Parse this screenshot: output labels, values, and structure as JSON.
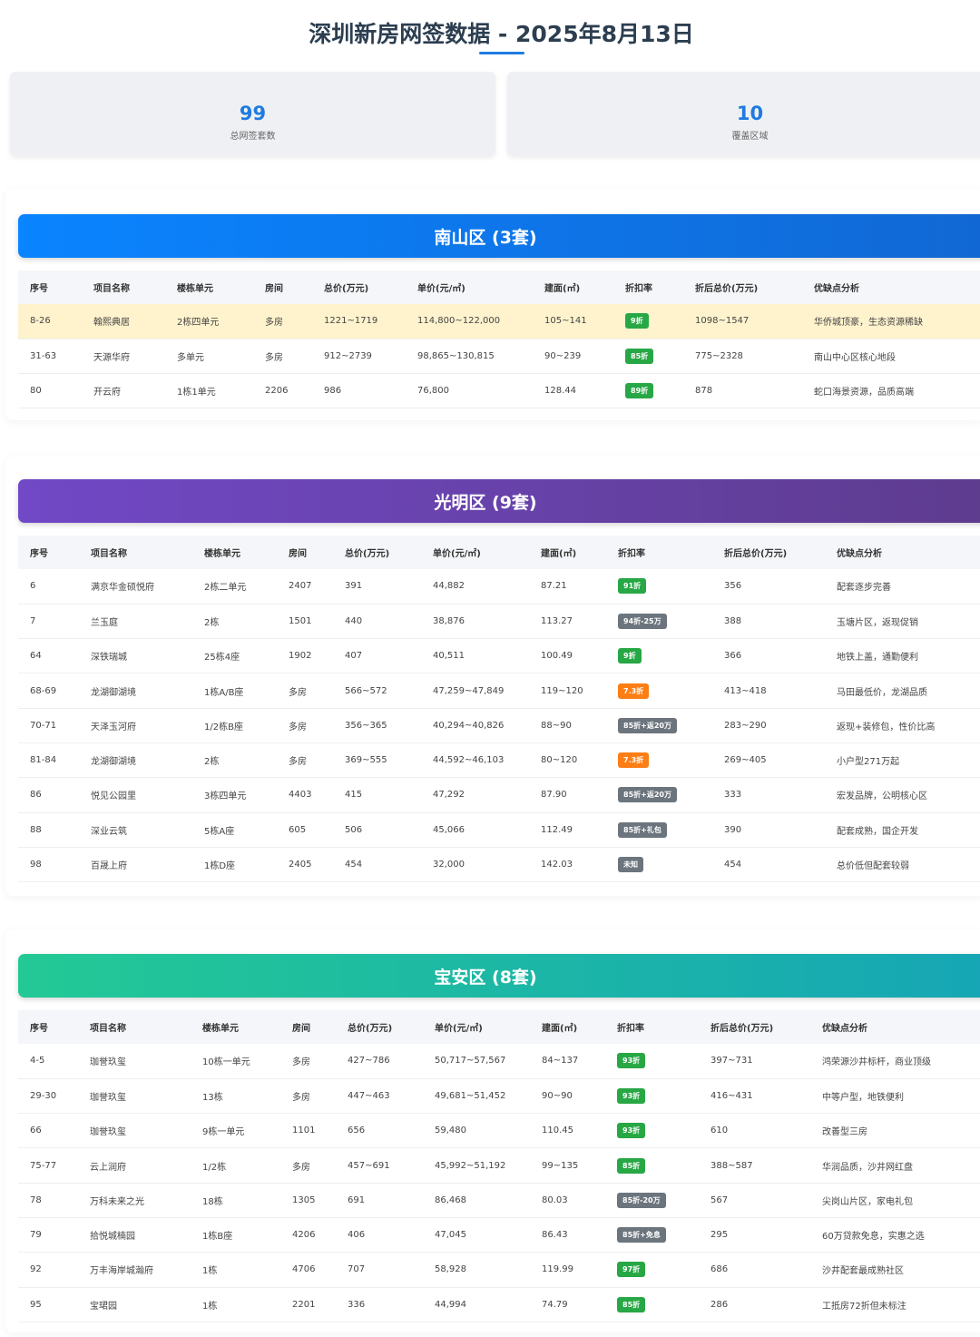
{
  "title": "深圳新房网签数据 - 2025年8月13日",
  "stats": [
    {
      "value": "99",
      "label": "总网签套数"
    },
    {
      "value": "10",
      "label": "覆盖区域"
    }
  ],
  "colors": {
    "accent": "#1e7be0",
    "green": "#28a745",
    "orange": "#fd7e14",
    "gray": "#6c757d",
    "highlight": "#fff3cd"
  },
  "districts": [
    {
      "title": "南山区 (3套)",
      "theme": "blue",
      "headers": [
        "序号",
        "项目名称",
        "楼栋单元",
        "房间",
        "总价(万元)",
        "单价(元/㎡)",
        "建面(㎡)",
        "折扣率",
        "折后总价(万元)",
        "优缺点分析"
      ],
      "rows": [
        {
          "no": "8-26",
          "project": "翰熙典居",
          "unit": "2栋四单元",
          "room": "多房",
          "total": "1221~1719",
          "unit_price": "114,800~122,000",
          "area": "105~141",
          "discount": "9折",
          "badge": "green",
          "after": "1098~1547",
          "note": "华侨城顶豪，生态资源稀缺",
          "highlight": true
        },
        {
          "no": "31-63",
          "project": "天源华府",
          "unit": "多单元",
          "room": "多房",
          "total": "912~2739",
          "unit_price": "98,865~130,815",
          "area": "90~239",
          "discount": "85折",
          "badge": "green",
          "after": "775~2328",
          "note": "南山中心区核心地段"
        },
        {
          "no": "80",
          "project": "开云府",
          "unit": "1栋1单元",
          "room": "2206",
          "total": "986",
          "unit_price": "76,800",
          "area": "128.44",
          "discount": "89折",
          "badge": "green",
          "after": "878",
          "note": "蛇口海景资源，品质高端"
        }
      ]
    },
    {
      "title": "光明区 (9套)",
      "theme": "purple",
      "headers": [
        "序号",
        "项目名称",
        "楼栋单元",
        "房间",
        "总价(万元)",
        "单价(元/㎡)",
        "建面(㎡)",
        "折扣率",
        "折后总价(万元)",
        "优缺点分析"
      ],
      "rows": [
        {
          "no": "6",
          "project": "满京华金硕悦府",
          "unit": "2栋二单元",
          "room": "2407",
          "total": "391",
          "unit_price": "44,882",
          "area": "87.21",
          "discount": "91折",
          "badge": "green",
          "after": "356",
          "note": "配套逐步完善"
        },
        {
          "no": "7",
          "project": "兰玉庭",
          "unit": "2栋",
          "room": "1501",
          "total": "440",
          "unit_price": "38,876",
          "area": "113.27",
          "discount": "94折-25万",
          "badge": "gray",
          "after": "388",
          "note": "玉塘片区，返现促销"
        },
        {
          "no": "64",
          "project": "深铁瑞城",
          "unit": "25栋4座",
          "room": "1902",
          "total": "407",
          "unit_price": "40,511",
          "area": "100.49",
          "discount": "9折",
          "badge": "green",
          "after": "366",
          "note": "地铁上盖，通勤便利"
        },
        {
          "no": "68-69",
          "project": "龙湖御湖境",
          "unit": "1栋A/B座",
          "room": "多房",
          "total": "566~572",
          "unit_price": "47,259~47,849",
          "area": "119~120",
          "discount": "7.3折",
          "badge": "orange",
          "after": "413~418",
          "note": "马田最低价，龙湖品质"
        },
        {
          "no": "70-71",
          "project": "天泽玉河府",
          "unit": "1/2栋B座",
          "room": "多房",
          "total": "356~365",
          "unit_price": "40,294~40,826",
          "area": "88~90",
          "discount": "85折+返20万",
          "badge": "gray",
          "after": "283~290",
          "note": "返现+装修包，性价比高"
        },
        {
          "no": "81-84",
          "project": "龙湖御湖境",
          "unit": "2栋",
          "room": "多房",
          "total": "369~555",
          "unit_price": "44,592~46,103",
          "area": "80~120",
          "discount": "7.3折",
          "badge": "orange",
          "after": "269~405",
          "note": "小户型271万起"
        },
        {
          "no": "86",
          "project": "悦见公园里",
          "unit": "3栋四单元",
          "room": "4403",
          "total": "415",
          "unit_price": "47,292",
          "area": "87.90",
          "discount": "85折+返20万",
          "badge": "gray",
          "after": "333",
          "note": "宏发品牌，公明核心区"
        },
        {
          "no": "88",
          "project": "深业云筑",
          "unit": "5栋A座",
          "room": "605",
          "total": "506",
          "unit_price": "45,066",
          "area": "112.49",
          "discount": "85折+礼包",
          "badge": "gray",
          "after": "390",
          "note": "配套成熟，国企开发"
        },
        {
          "no": "98",
          "project": "百晟上府",
          "unit": "1栋D座",
          "room": "2405",
          "total": "454",
          "unit_price": "32,000",
          "area": "142.03",
          "discount": "未知",
          "badge": "gray",
          "after": "454",
          "note": "总价低但配套较弱"
        }
      ]
    },
    {
      "title": "宝安区 (8套)",
      "theme": "teal",
      "headers": [
        "序号",
        "项目名称",
        "楼栋单元",
        "房间",
        "总价(万元)",
        "单价(元/㎡)",
        "建面(㎡)",
        "折扣率",
        "折后总价(万元)",
        "优缺点分析"
      ],
      "rows": [
        {
          "no": "4-5",
          "project": "珈誉玖玺",
          "unit": "10栋一单元",
          "room": "多房",
          "total": "427~786",
          "unit_price": "50,717~57,567",
          "area": "84~137",
          "discount": "93折",
          "badge": "green",
          "after": "397~731",
          "note": "鸿荣源沙井标杆，商业顶级"
        },
        {
          "no": "29-30",
          "project": "珈誉玖玺",
          "unit": "13栋",
          "room": "多房",
          "total": "447~463",
          "unit_price": "49,681~51,452",
          "area": "90~90",
          "discount": "93折",
          "badge": "green",
          "after": "416~431",
          "note": "中等户型，地铁便利"
        },
        {
          "no": "66",
          "project": "珈誉玖玺",
          "unit": "9栋一单元",
          "room": "1101",
          "total": "656",
          "unit_price": "59,480",
          "area": "110.45",
          "discount": "93折",
          "badge": "green",
          "after": "610",
          "note": "改善型三房"
        },
        {
          "no": "75-77",
          "project": "云上润府",
          "unit": "1/2栋",
          "room": "多房",
          "total": "457~691",
          "unit_price": "45,992~51,192",
          "area": "99~135",
          "discount": "85折",
          "badge": "green",
          "after": "388~587",
          "note": "华润品质，沙井网红盘"
        },
        {
          "no": "78",
          "project": "万科未来之光",
          "unit": "18栋",
          "room": "1305",
          "total": "691",
          "unit_price": "86,468",
          "area": "80.03",
          "discount": "85折-20万",
          "badge": "gray",
          "after": "567",
          "note": "尖岗山片区，家电礼包"
        },
        {
          "no": "79",
          "project": "拾悦城楠园",
          "unit": "1栋B座",
          "room": "4206",
          "total": "406",
          "unit_price": "47,045",
          "area": "86.43",
          "discount": "85折+免息",
          "badge": "gray",
          "after": "295",
          "note": "60万贷款免息，实惠之选"
        },
        {
          "no": "92",
          "project": "万丰海岸城瀚府",
          "unit": "1栋",
          "room": "4706",
          "total": "707",
          "unit_price": "58,928",
          "area": "119.99",
          "discount": "97折",
          "badge": "green",
          "after": "686",
          "note": "沙井配套最成熟社区"
        },
        {
          "no": "95",
          "project": "宝珺园",
          "unit": "1栋",
          "room": "2201",
          "total": "336",
          "unit_price": "44,994",
          "area": "74.79",
          "discount": "85折",
          "badge": "green",
          "after": "286",
          "note": "工抵房72折但未标注"
        }
      ]
    }
  ]
}
